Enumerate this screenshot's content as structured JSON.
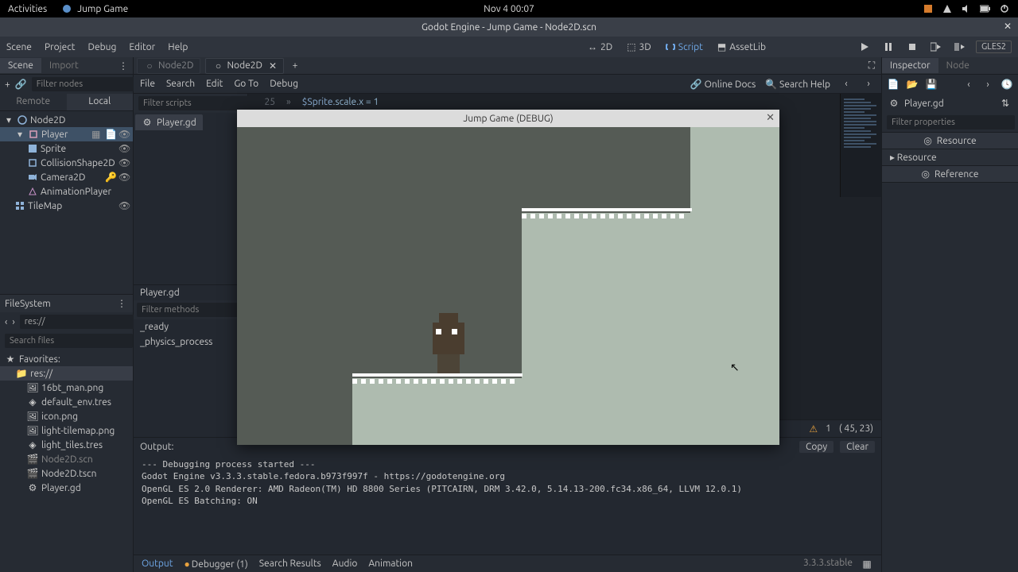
{
  "gnome": {
    "activities": "Activities",
    "app_name": "Jump Game",
    "clock": "Nov 4  00:07"
  },
  "window_title": "Godot Engine - Jump Game - Node2D.scn",
  "main_menu": {
    "scene": "Scene",
    "project": "Project",
    "debug": "Debug",
    "editor": "Editor",
    "help": "Help"
  },
  "modes": {
    "m2d": "2D",
    "m3d": "3D",
    "script": "Script",
    "assetlib": "AssetLib"
  },
  "gles": "GLES2",
  "scene_dock": {
    "tab_scene": "Scene",
    "tab_import": "Import",
    "filter_ph": "Filter nodes",
    "subtab_remote": "Remote",
    "subtab_local": "Local",
    "nodes": {
      "root": "Node2D",
      "player": "Player",
      "sprite": "Sprite",
      "collision": "CollisionShape2D",
      "camera": "Camera2D",
      "anim": "AnimationPlayer",
      "tilemap": "TileMap"
    }
  },
  "filesystem": {
    "title": "FileSystem",
    "path": "res://",
    "search_ph": "Search files",
    "favorites": "Favorites:",
    "root": "res://",
    "files": [
      "16bt_man.png",
      "default_env.tres",
      "icon.png",
      "light-tilemap.png",
      "light_tiles.tres",
      "Node2D.scn",
      "Node2D.tscn",
      "Player.gd"
    ]
  },
  "center": {
    "tabs": {
      "t1": "Node2D",
      "t2": "Node2D"
    },
    "script_menu": {
      "file": "File",
      "search": "Search",
      "edit": "Edit",
      "goto": "Go To",
      "debug": "Debug",
      "online_docs": "Online Docs",
      "search_help": "Search Help"
    },
    "filter_scripts_ph": "Filter scripts",
    "filter_methods_ph": "Filter methods",
    "open_script": "Player.gd",
    "script_tab": "Player.gd",
    "methods": {
      "m1": "_ready",
      "m2": "_physics_process"
    },
    "code": {
      "line_no": "25",
      "guide": "»",
      "text_pre": "$Sprite",
      "text_mid": ".scale.x = ",
      "text_val": "1"
    },
    "status": {
      "warn_count": "1",
      "cursor": "( 45, 23)"
    }
  },
  "output": {
    "title": "Output:",
    "copy": "Copy",
    "clear": "Clear",
    "body": "--- Debugging process started ---\nGodot Engine v3.3.3.stable.fedora.b973f997f - https://godotengine.org\nOpenGL ES 2.0 Renderer: AMD Radeon(TM) HD 8800 Series (PITCAIRN, DRM 3.42.0, 5.14.13-200.fc34.x86_64, LLVM 12.0.1)\nOpenGL ES Batching: ON\n "
  },
  "bottom": {
    "output": "Output",
    "debugger": "Debugger (1)",
    "search": "Search Results",
    "audio": "Audio",
    "animation": "Animation",
    "version": "3.3.3.stable"
  },
  "inspector": {
    "tab_inspector": "Inspector",
    "tab_node": "Node",
    "object": "Player.gd",
    "filter_ph": "Filter properties",
    "resource_head": "Resource",
    "resource_row": "Resource",
    "reference_head": "Reference"
  },
  "game": {
    "title": "Jump Game (DEBUG)"
  }
}
